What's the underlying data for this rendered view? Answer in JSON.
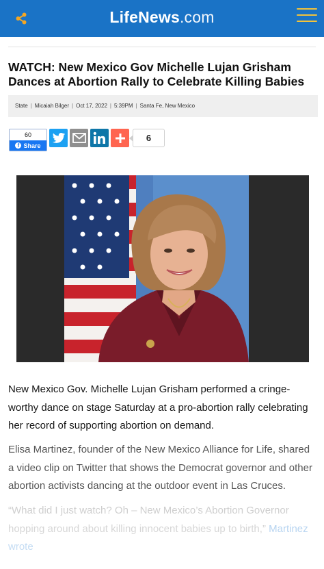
{
  "header": {
    "brand": "LifeNews",
    "tld": ".com",
    "icons": {
      "share": "share-icon",
      "menu": "hamburger-menu-icon"
    },
    "colors": {
      "bar": "#1a73c6",
      "share_icon": "#f4a623",
      "menu_icon": "#f4c33a"
    }
  },
  "article": {
    "headline": "WATCH: New Mexico Gov Michelle Lujan Grisham Dances at Abortion Rally to Celebrate Killing Babies",
    "meta": {
      "category": "State",
      "author": "Micaiah Bilger",
      "date": "Oct 17, 2022",
      "time": "5:39PM",
      "location": "Santa Fe, New Mexico"
    },
    "share": {
      "facebook_count": "60",
      "facebook_label": "Share",
      "share_count": "6",
      "icons": [
        "facebook-icon",
        "twitter-icon",
        "email-icon",
        "linkedin-icon",
        "add-more-icon"
      ]
    },
    "image": {
      "subject": "official portrait with american flag"
    },
    "paragraphs": {
      "p1": "New Mexico Gov. Michelle Lujan Grisham performed a cringe-worthy dance on stage Saturday at a pro-abortion rally celebrating her record of supporting abortion on demand.",
      "p2": "Elisa Martinez, founder of the New Mexico Alliance for Life, shared a video clip on Twitter that shows the Democrat governor and other abortion activists dancing at the outdoor event in Las Cruces.",
      "p3_text": "“What did I just watch? Oh – New Mexico’s Abortion Governor hopping around about killing innocent babies up to birth,”",
      "p3_link": "Martinez wrote"
    }
  }
}
